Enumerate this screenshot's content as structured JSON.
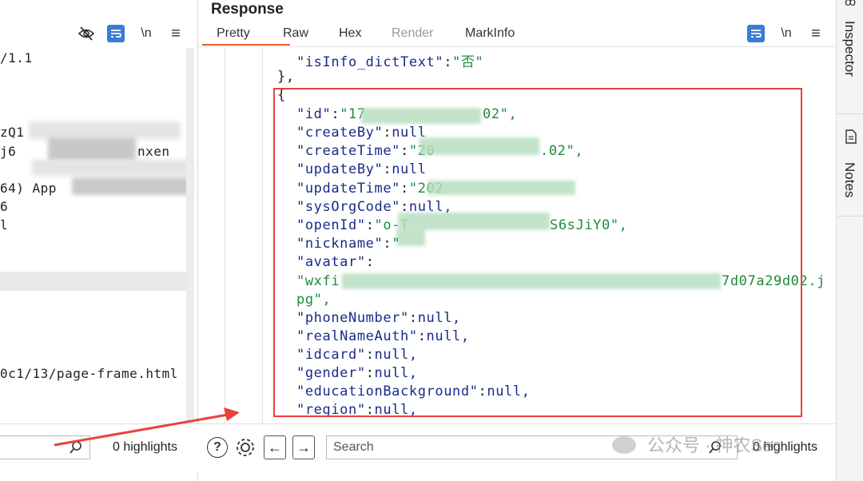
{
  "request_pane": {
    "toolbar": {
      "wrap_label": "\\n"
    },
    "lines": {
      "line1": "/1.1",
      "line2": "zQ1",
      "line3": "j6",
      "line3_tail": "nxen",
      "line4": "64) App",
      "line5": "6",
      "line6": "l",
      "line7": "0c1/13/page-frame.html"
    }
  },
  "response": {
    "title": "Response",
    "tabs": [
      "Pretty",
      "Raw",
      "Hex",
      "Render",
      "MarkInfo"
    ],
    "active_tab": "Pretty",
    "wrap_label": "\\n",
    "code": {
      "l1_key": "\"isInfo_dictText\"",
      "l1_val": "\"否\"",
      "l2": "},",
      "l3": "{",
      "id_key": "\"id\"",
      "id_val_a": "\"17",
      "id_val_b": "02\",",
      "createBy_key": "\"createBy\"",
      "createTime_key": "\"createTime\"",
      "createTime_val_a": "\"20",
      "createTime_val_b": ".02\",",
      "updateBy_key": "\"updateBy\"",
      "updateTime_key": "\"updateTime\"",
      "updateTime_val_a": "\"202",
      "sysOrgCode_key": "\"sysOrgCode\"",
      "openId_key": "\"openId\"",
      "openId_val_a": "\"o-T",
      "openId_val_b": "S6sJiY0\",",
      "nickname_key": "\"nickname\"",
      "nickname_val_a": "\"",
      "avatar_key": "\"avatar\"",
      "avatar_val_a": "\"wxfi",
      "avatar_val_b": "7d07a29d02.j",
      "avatar_val_c": "pg\",",
      "phoneNumber_key": "\"phoneNumber\"",
      "realNameAuth_key": "\"realNameAuth\"",
      "idcard_key": "\"idcard\"",
      "gender_key": "\"gender\"",
      "educationBackground_key": "\"educationBackground\"",
      "region_key": "\"region\"",
      "null_comma": "null,",
      "null_plain": "null",
      "colon": ":"
    }
  },
  "bottom": {
    "left_highlights": "0 highlights",
    "search_placeholder": "Search",
    "right_highlights": "0 highlights"
  },
  "sidebar": {
    "inspector": "Inspector",
    "notes": "Notes"
  },
  "watermark": "公众号 · 神农Sec",
  "colors": {
    "accent": "#f05a28",
    "button_blue": "#3a7bd5",
    "annotation_red": "#e8413e",
    "json_key": "#1a2a8a",
    "json_string": "#1e8a3a"
  }
}
